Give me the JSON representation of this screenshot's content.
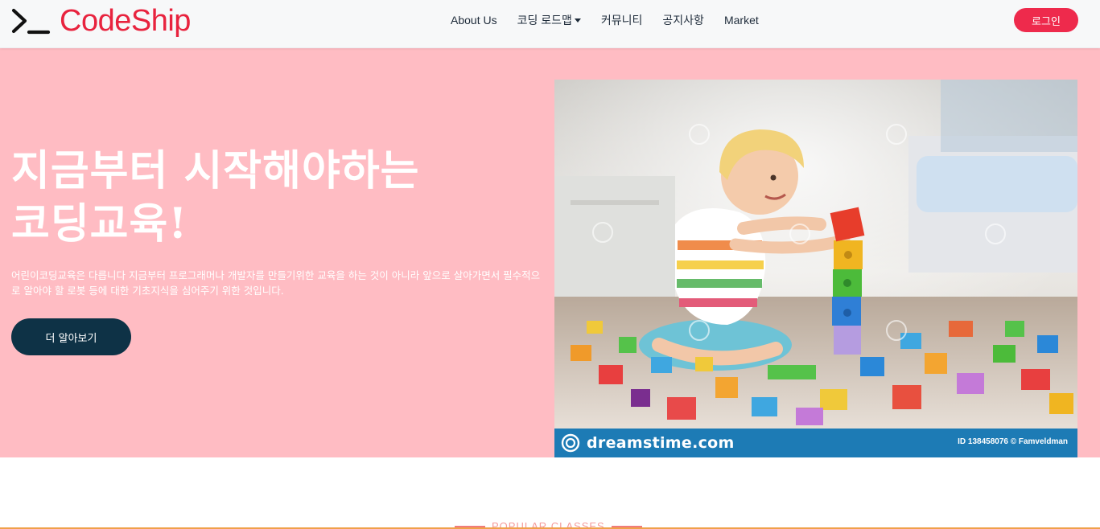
{
  "header": {
    "logo_text": "CodeShip",
    "nav": [
      {
        "label": "About Us",
        "dropdown": false
      },
      {
        "label": "코딩 로드맵",
        "dropdown": true
      },
      {
        "label": "커뮤니티",
        "dropdown": false
      },
      {
        "label": "공지사항",
        "dropdown": false
      },
      {
        "label": "Market",
        "dropdown": false
      }
    ],
    "login_label": "로그인"
  },
  "hero": {
    "title_line1": "지금부터 시작해야하는",
    "title_line2": "코딩교육!",
    "description": "어린이코딩교육은 다릅니다 지금부터 프로그래머나 개발자를 만들기위한 교육을 하는 것이 아니라 앞으로 살아가면서 필수적으로 알아야 할 로봇 등에 대한 기초지식을 심어주기 위한 것입니다.",
    "cta_label": "더 알아보기",
    "image": {
      "stock_name": "dreamstime.com",
      "stock_id": "ID 138458076 © Famveldman"
    }
  },
  "section": {
    "label": "POPULAR CLASSES"
  },
  "colors": {
    "brand": "#e8233e",
    "hero_bg": "#ffbcc3",
    "cta_bg": "#0e3246",
    "login_bg": "#ee2a4c"
  },
  "icons": {
    "logo": "terminal-prompt-icon",
    "dropdown": "caret-down-icon",
    "stock": "dreamstime-spiral-icon"
  }
}
